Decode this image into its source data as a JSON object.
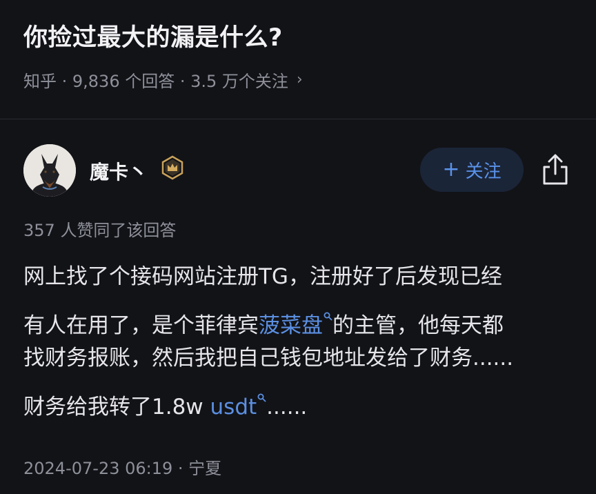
{
  "question": {
    "title": "你捡过最大的漏是什么?",
    "meta": "知乎 · 9,836 个回答 · 3.5 万个关注",
    "chevron": "›"
  },
  "author": {
    "name": "魔卡丶",
    "badge_icon": "crown-badge-icon",
    "follow_plus": "+",
    "follow_label": "关注",
    "share_icon": "share-icon"
  },
  "answer": {
    "votes": "357 人赞同了该回答",
    "line1": "网上找了个接码网站注册TG，注册好了后发现已经",
    "line2_pre": "有人在用了，是个菲律宾",
    "line2_kw": "菠菜盘",
    "line2_post": "的主管，他每天都",
    "line3": "找财务报账，然后我把自己钱包地址发给了财务......",
    "line4_pre": "财务给我转了1.8w ",
    "line4_kw": "usdt",
    "line4_post": "......",
    "timestamp": "2024-07-23 06:19 · 宁夏"
  },
  "colors": {
    "background": "#121317",
    "accent": "#5b8fe2",
    "muted": "#8e909a",
    "follow_bg": "#1b2538"
  }
}
